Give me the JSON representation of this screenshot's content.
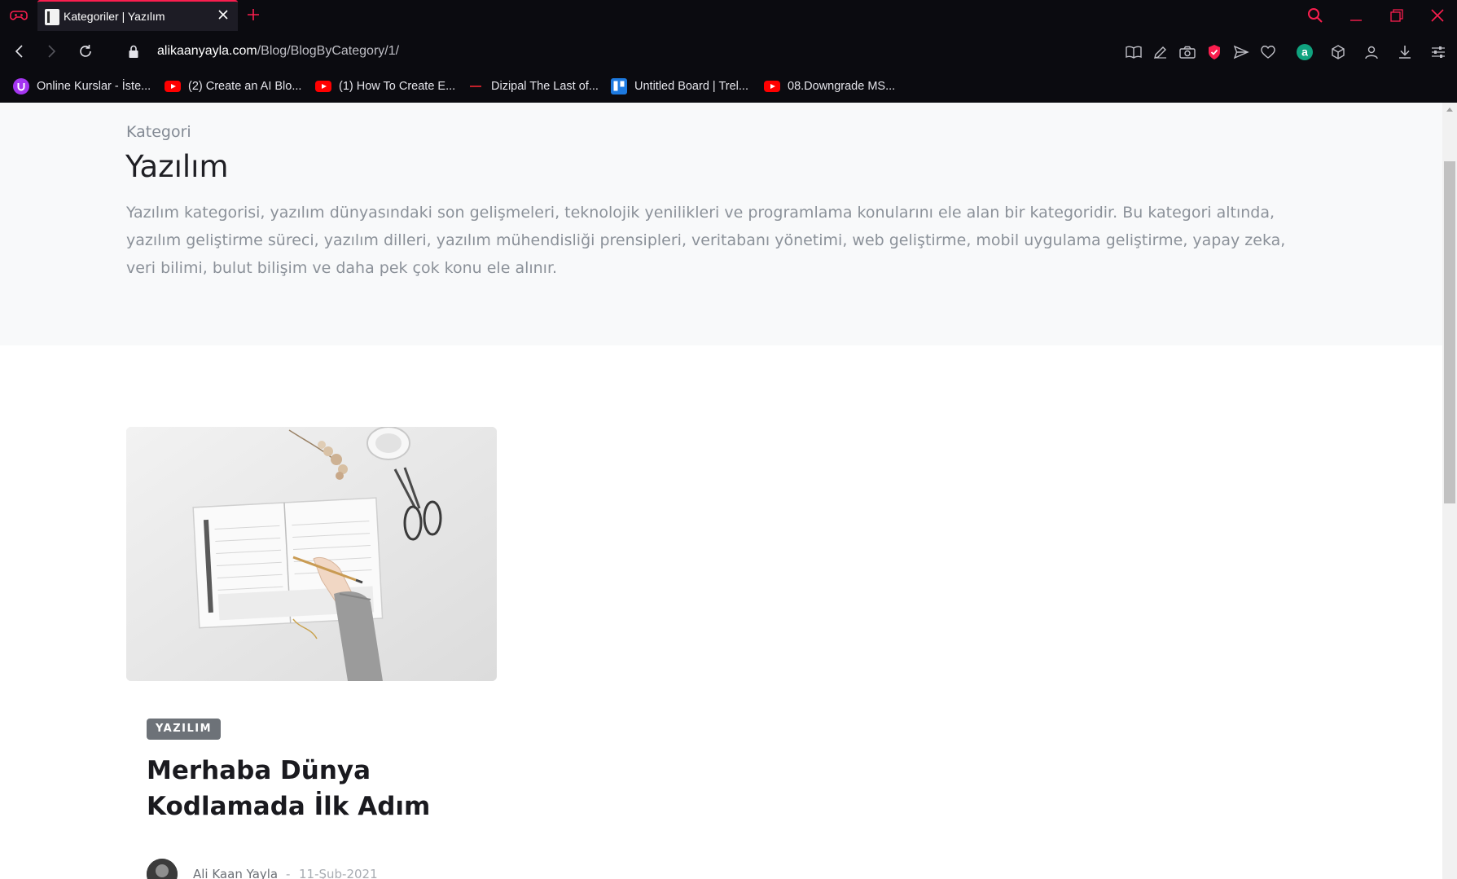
{
  "browser": {
    "tab": {
      "title": "Kategoriler | Yazılım"
    },
    "address": {
      "host": "alikaanyayla.com",
      "path": "/Blog/BlogByCategory/1/"
    },
    "bookmarks": [
      {
        "label": "Online Kurslar - İste...",
        "icon": "udemy-icon"
      },
      {
        "label": "(2) Create an AI Blo...",
        "icon": "youtube-icon"
      },
      {
        "label": "(1) How To Create E...",
        "icon": "youtube-icon"
      },
      {
        "label": "Dizipal The Last of...",
        "icon": "dizipal-icon"
      },
      {
        "label": "Untitled Board | Trel...",
        "icon": "trello-icon"
      },
      {
        "label": "08.Downgrade MS...",
        "icon": "youtube-icon"
      }
    ],
    "colors": {
      "accent": "#fa1e4e",
      "chrome_bg": "#0b0b10"
    }
  },
  "page": {
    "hero": {
      "eyebrow": "Kategori",
      "title": "Yazılım",
      "description": "Yazılım kategorisi, yazılım dünyasındaki son gelişmeleri, teknolojik yenilikleri ve programlama konularını ele alan bir kategoridir. Bu kategori altında, yazılım geliştirme süreci, yazılım dilleri, yazılım mühendisliği prensipleri, veritabanı yönetimi, web geliştirme, mobil uygulama geliştirme, yapay zeka, veri bilimi, bulut bilişim ve daha pek çok konu ele alınır."
    },
    "post": {
      "category_badge": "YAZILIM",
      "title": "Merhaba Dünya Kodlamada İlk Adım",
      "author": "Ali Kaan Yayla",
      "separator": "-",
      "date": "11-Şub-2021"
    }
  }
}
